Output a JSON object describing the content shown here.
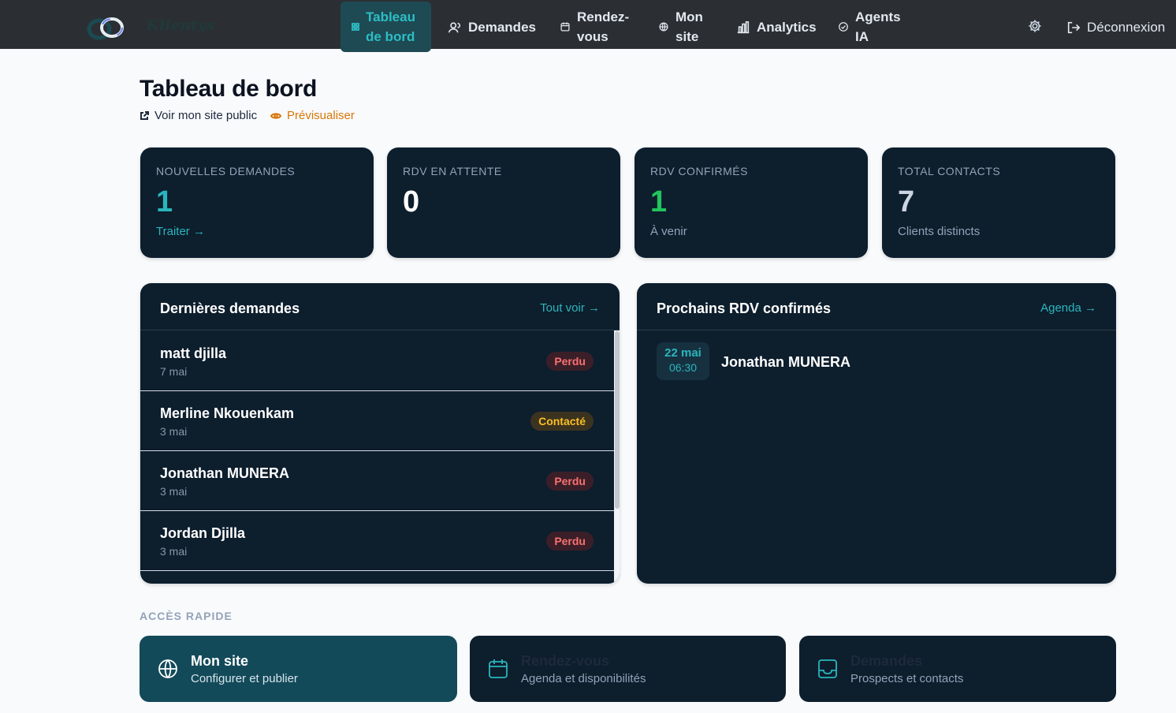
{
  "nav": {
    "brand": "Klientys",
    "items": [
      {
        "label_line1": "Tableau",
        "label_line2": "de bord",
        "icon": "grid-icon",
        "active": true
      },
      {
        "label": "Demandes",
        "icon": "users-icon"
      },
      {
        "label_line1": "Rendez-",
        "label_line2": "vous",
        "icon": "calendar-icon"
      },
      {
        "label_line1": "Mon",
        "label_line2": "site",
        "icon": "globe-icon"
      },
      {
        "label": "Analytics",
        "icon": "bar-chart-icon"
      },
      {
        "label_line1": "Agents",
        "label_line2": "IA",
        "icon": "bot-icon"
      }
    ],
    "settings_icon": "gear-icon",
    "logout_label": "Déconnexion"
  },
  "header": {
    "title": "Tableau de bord",
    "public_site_link": "Voir mon site public",
    "preview_link": "Prévisualiser"
  },
  "stats": [
    {
      "label": "NOUVELLES DEMANDES",
      "value": "1",
      "sub": "Traiter →",
      "color": "#2ab5bd"
    },
    {
      "label": "RDV EN ATTENTE",
      "value": "0",
      "sub": "",
      "color": "#ffffff"
    },
    {
      "label": "RDV CONFIRMÉS",
      "value": "1",
      "sub": "À venir",
      "color": "#22c55e"
    },
    {
      "label": "TOTAL CONTACTS",
      "value": "7",
      "sub": "Clients distincts",
      "color": "#cbd5e1"
    }
  ],
  "requests_panel": {
    "title": "Dernières demandes",
    "link": "Tout voir →",
    "rows": [
      {
        "name": "matt djilla",
        "date": "7 mai",
        "status": "Perdu"
      },
      {
        "name": "Merline Nkouenkam",
        "date": "3 mai",
        "status": "Contacté"
      },
      {
        "name": "Jonathan MUNERA",
        "date": "3 mai",
        "status": "Perdu"
      },
      {
        "name": "Jordan Djilla",
        "date": "3 mai",
        "status": "Perdu"
      }
    ]
  },
  "appointments_panel": {
    "title": "Prochains RDV confirmés",
    "link": "Agenda →",
    "items": [
      {
        "day": "22 mai",
        "time": "06:30",
        "name": "Jonathan MUNERA"
      }
    ]
  },
  "quick_access": {
    "label": "ACCÈS RAPIDE",
    "cards": [
      {
        "title": "Mon site",
        "sub": "Configurer et publier",
        "icon": "globe-icon"
      },
      {
        "title": "Rendez-vous",
        "sub": "Agenda et disponibilités",
        "icon": "calendar-icon"
      },
      {
        "title": "Demandes",
        "sub": "Prospects et contacts",
        "icon": "inbox-icon"
      }
    ]
  }
}
